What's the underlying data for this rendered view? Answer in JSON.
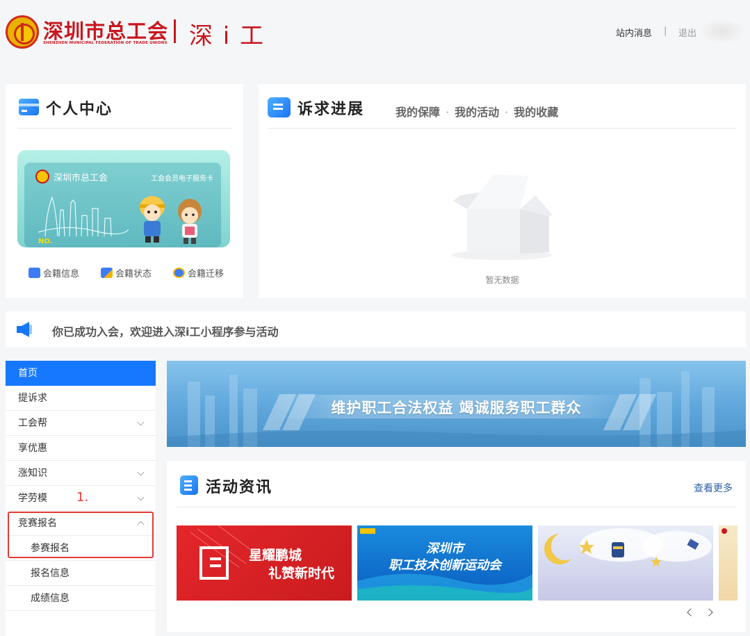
{
  "header": {
    "org_name": "深圳市总工会",
    "org_name_en": "SHENZHEN MUNICIPAL FEDERATION OF TRADE UNIONS",
    "app_name": "深 i 工",
    "messages_label": "站内消息",
    "separator": "|",
    "logout_label": "退出",
    "brand_color": "#c8161d"
  },
  "personal_center": {
    "title": "个人中心",
    "member_card": {
      "org_name": "深圳市总工会",
      "service_label": "工会会员电子服务卡",
      "number_label": "NO."
    },
    "actions": [
      {
        "label": "会籍信息",
        "icon": "chat-icon"
      },
      {
        "label": "会籍状态",
        "icon": "user-badge-icon"
      },
      {
        "label": "会籍迁移",
        "icon": "medal-icon"
      }
    ]
  },
  "appeal_progress": {
    "title": "诉求进展",
    "tabs": [
      "我的保障",
      "我的活动",
      "我的收藏"
    ],
    "tab_separator": "·",
    "empty_text": "暂无数据"
  },
  "notice": {
    "text": "你已成功入会，欢迎进入深i工小程序参与活动"
  },
  "sidebar": {
    "accent_color": "#1677ff",
    "items": [
      {
        "label": "首页",
        "active": true
      },
      {
        "label": "提诉求"
      },
      {
        "label": "工会帮",
        "expandable": true
      },
      {
        "label": "享优惠"
      },
      {
        "label": "涨知识",
        "expandable": true
      },
      {
        "label": "学劳模",
        "expandable": true
      },
      {
        "label": "竞赛报名",
        "expanded": true
      },
      {
        "label": "参赛报名",
        "sub": true
      },
      {
        "label": "报名信息",
        "sub": true
      },
      {
        "label": "成绩信息",
        "sub": true
      }
    ]
  },
  "annotation": {
    "number": "1.",
    "color": "#e53935"
  },
  "banner": {
    "text": "维护职工合法权益  竭诚服务职工群众"
  },
  "news": {
    "title": "活动资讯",
    "more_label": "查看更多",
    "items": [
      {
        "line1": "星耀鹏城",
        "line2": "礼赞新时代"
      },
      {
        "line1": "深圳市",
        "line2": "职工技术创新运动会"
      },
      {
        "line1": "",
        "line2": ""
      },
      {
        "line1": "",
        "line2": ""
      }
    ]
  }
}
